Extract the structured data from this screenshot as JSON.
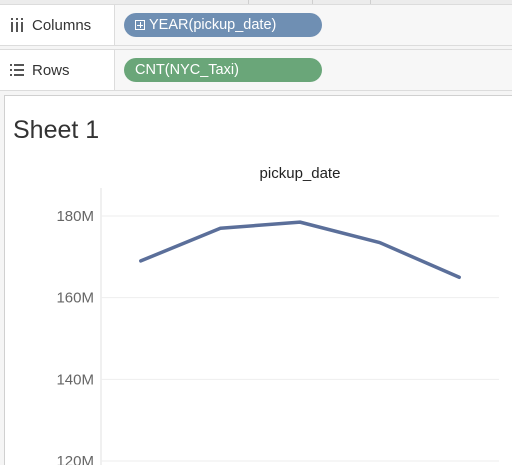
{
  "shelves": {
    "columns": {
      "label": "Columns",
      "icon": "columns-icon",
      "pill": "YEAR(pickup_date)",
      "pill_color": "#6f8fb3"
    },
    "rows": {
      "label": "Rows",
      "icon": "rows-icon",
      "pill": "CNT(NYC_Taxi)",
      "pill_color": "#6aa679"
    }
  },
  "sheet": {
    "title": "Sheet 1"
  },
  "chart_data": {
    "type": "line",
    "title": "pickup_date",
    "y_ticks": [
      "180M",
      "160M",
      "140M",
      "120M"
    ],
    "y_tick_values": [
      180,
      160,
      140,
      120
    ],
    "ylim": [
      120,
      180
    ],
    "y_unit": "M",
    "x_count": 5,
    "values": [
      169,
      177,
      178.5,
      173.5,
      165
    ],
    "line_color": "#5b6f9a",
    "grid": true
  }
}
